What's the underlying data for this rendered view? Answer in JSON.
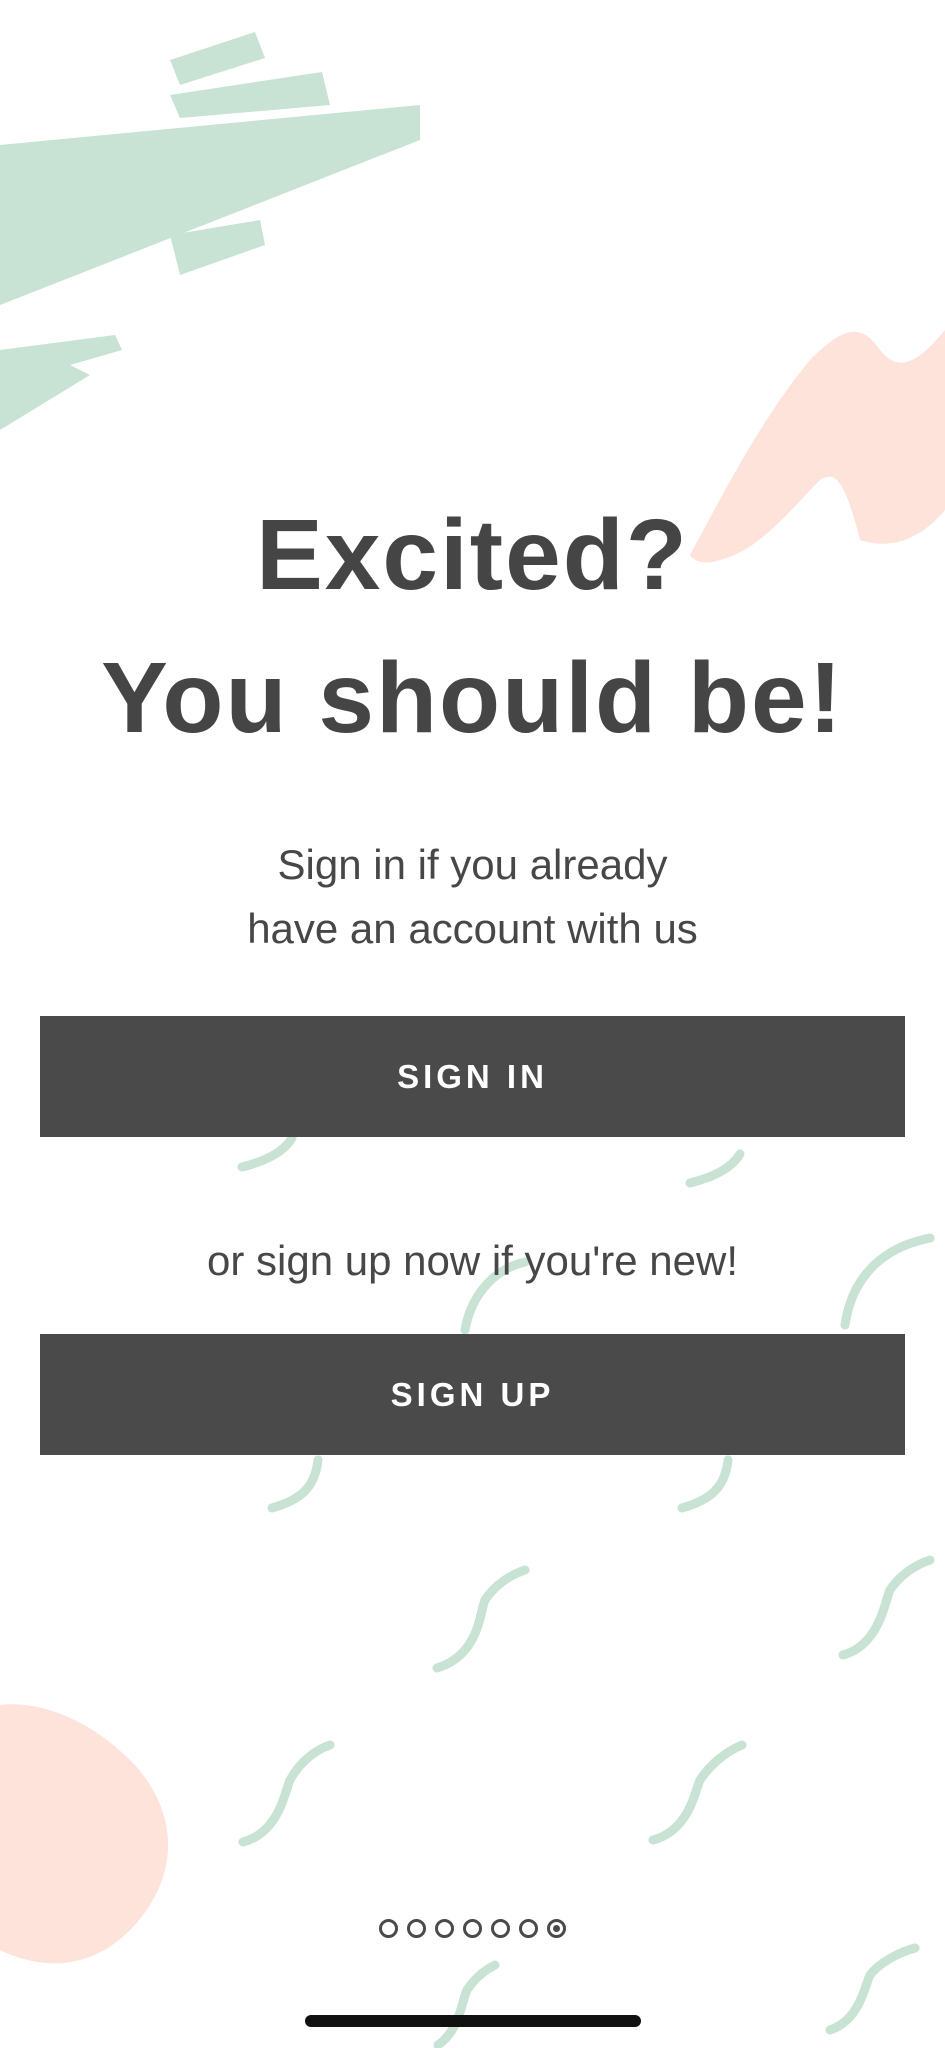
{
  "colors": {
    "background": "#ffffff",
    "text": "#474747",
    "button": "#4a4a4a",
    "button_text": "#ffffff",
    "mint_decor": "#c8e2d4",
    "peach_decor": "#fde3d9"
  },
  "headline": {
    "line1": "Excited?",
    "line2": "You should be!"
  },
  "signin_prompt": {
    "line1": "Sign in if you already",
    "line2": "have an account with us"
  },
  "signin_button": "SIGN IN",
  "signup_prompt": "or sign up now if you're new!",
  "signup_button": "SIGN UP",
  "pager": {
    "total_pages": 7,
    "current_page": 7
  }
}
